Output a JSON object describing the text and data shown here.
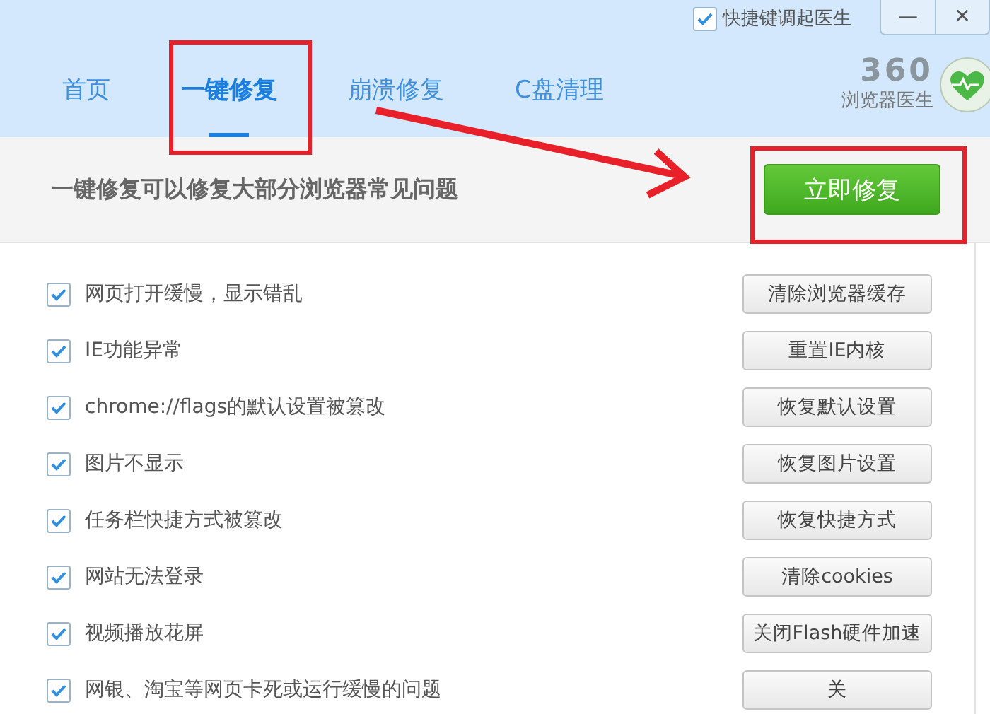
{
  "hotkey_option": {
    "label": "快捷键调起医生",
    "checked": true
  },
  "window_controls": [
    "—",
    "✕"
  ],
  "tabs": [
    {
      "label": "首页",
      "selected": false
    },
    {
      "label": "一键修复",
      "selected": true
    },
    {
      "label": "崩溃修复",
      "selected": false
    },
    {
      "label": "C盘清理",
      "selected": false
    }
  ],
  "logo": {
    "number": "360",
    "name": "浏览器医生"
  },
  "banner": {
    "text": "一键修复可以修复大部分浏览器常见问题",
    "button": "立即修复"
  },
  "items": [
    {
      "label": "网页打开缓慢，显示错乱",
      "checked": true,
      "action": "清除浏览器缓存"
    },
    {
      "label": "IE功能异常",
      "checked": true,
      "action": "重置IE内核"
    },
    {
      "label": "chrome://flags的默认设置被篡改",
      "checked": true,
      "action": "恢复默认设置"
    },
    {
      "label": "图片不显示",
      "checked": true,
      "action": "恢复图片设置"
    },
    {
      "label": "任务栏快捷方式被篡改",
      "checked": true,
      "action": "恢复快捷方式"
    },
    {
      "label": "网站无法登录",
      "checked": true,
      "action": "清除cookies"
    },
    {
      "label": "视频播放花屏",
      "checked": true,
      "action": "关闭Flash硬件加速"
    },
    {
      "label": "网银、淘宝等网页卡死或运行缓慢的问题",
      "checked": true,
      "action": "关"
    }
  ]
}
